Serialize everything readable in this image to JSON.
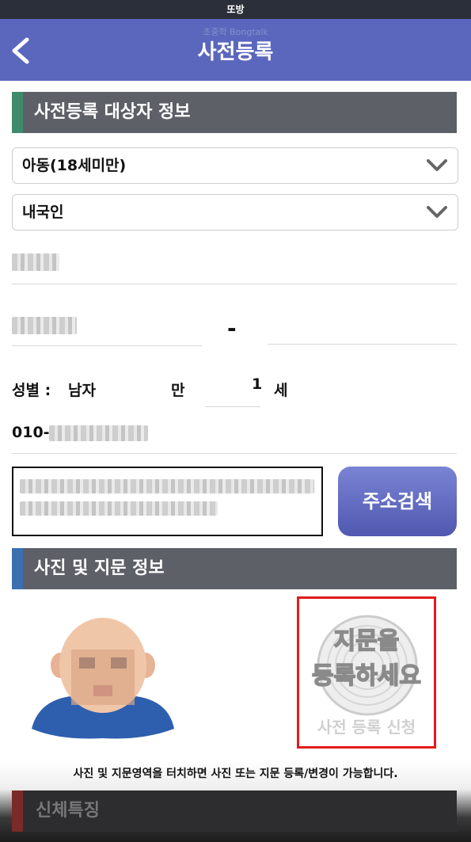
{
  "status_bar": {
    "title": "또방"
  },
  "app_bar": {
    "title": "사전등록",
    "faint_text": "초중학 Bongtalk"
  },
  "section_target": {
    "title": "사전등록 대상자 정보",
    "accent_color": "#3f8a6a"
  },
  "age_select": {
    "value": "아동(18세미만)"
  },
  "nationality_select": {
    "value": "내국인"
  },
  "id_number": {
    "separator": "-"
  },
  "gender": {
    "label": "성별 :",
    "value": "남자"
  },
  "age": {
    "prefix": "만",
    "value": "1",
    "suffix": "세"
  },
  "phone": {
    "prefix": "010-"
  },
  "address": {
    "search_button": "주소검색"
  },
  "section_photo": {
    "title": "사진 및 지문 정보",
    "accent_color": "#3a6fb0"
  },
  "fingerprint": {
    "line1": "지문을",
    "line2": "등록하세요",
    "caption": "사전 등록 신청"
  },
  "notice": "사진 및 지문영역을 터치하면 사진 또는 지문 등록/변경이 가능합니다.",
  "section_body": {
    "title": "신체특징"
  },
  "icons": [
    "back-arrow-icon",
    "chevron-down-icon",
    "fingerprint-icon"
  ]
}
